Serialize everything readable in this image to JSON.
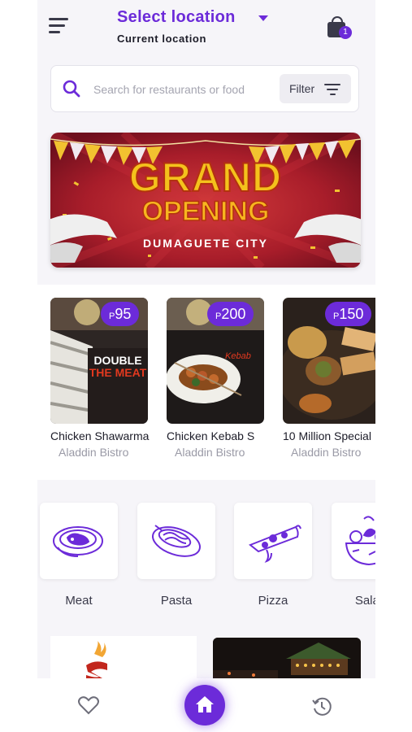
{
  "header": {
    "location_title": "Select location",
    "location_subtitle": "Current location",
    "cart_count": "1"
  },
  "search": {
    "placeholder": "Search for restaurants or food",
    "filter_label": "Filter"
  },
  "banner": {
    "line1": "GRAND",
    "line2": "OPENING",
    "line3": "DUMAGUETE CITY"
  },
  "products": [
    {
      "price_symbol": "P",
      "price": "95",
      "name": "Chicken Shawarma",
      "store": "Aladdin Bistro",
      "image_text": [
        "DOUBLE",
        "THE MEAT"
      ]
    },
    {
      "price_symbol": "P",
      "price": "200",
      "name": "Chicken Kebab S",
      "store": "Aladdin Bistro",
      "image_text": [
        "Kebab"
      ]
    },
    {
      "price_symbol": "P",
      "price": "150",
      "name": "10 Million Special",
      "store": "Aladdin Bistro"
    }
  ],
  "categories": [
    {
      "label": "Meat",
      "icon": "meat-icon"
    },
    {
      "label": "Pasta",
      "icon": "pasta-icon"
    },
    {
      "label": "Pizza",
      "icon": "pizza-icon"
    },
    {
      "label": "Salad",
      "icon": "salad-icon"
    }
  ],
  "nav": {
    "items": [
      "heart-icon",
      "home-icon",
      "history-icon"
    ]
  },
  "colors": {
    "accent": "#6c2bd9",
    "text_dark": "#1c1c28",
    "text_muted": "#9a9aa6"
  }
}
